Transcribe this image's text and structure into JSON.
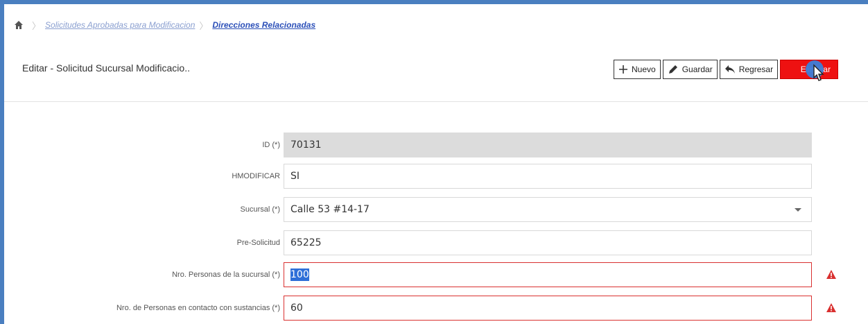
{
  "breadcrumb": {
    "home_icon": "home-icon",
    "items": [
      {
        "label": "Solicitudes Aprobadas para Modificacion"
      },
      {
        "label": "Direcciones Relacionadas"
      }
    ]
  },
  "page_title": "Editar - Solicitud Sucursal Modificacio..",
  "toolbar": {
    "nuevo_label": "Nuevo",
    "guardar_label": "Guardar",
    "regresar_label": "Regresar",
    "eliminar_label": "Eliminar"
  },
  "form": {
    "id": {
      "label": "ID (*)",
      "value": "70131"
    },
    "hmodificar": {
      "label": "HMODIFICAR",
      "value": "SI"
    },
    "sucursal": {
      "label": "Sucursal (*)",
      "value": "Calle 53 #14-17"
    },
    "pre_solicitud": {
      "label": "Pre-Solicitud",
      "value": "65225"
    },
    "nro_personas": {
      "label": "Nro. Personas de la sucursal (*)",
      "value": "100"
    },
    "nro_personas_contacto": {
      "label": "Nro. de Personas en contacto con sustancias (*)",
      "value": "60"
    }
  },
  "colors": {
    "accent": "#4a7fc0",
    "danger": "#ee1111",
    "error_border": "#d9302f",
    "link": "#2b4fb8"
  }
}
